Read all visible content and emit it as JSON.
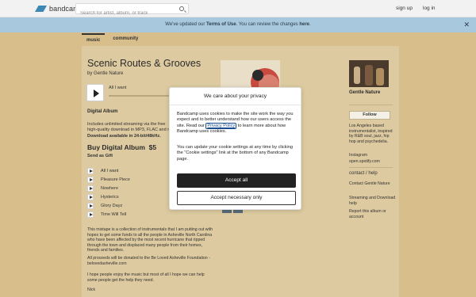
{
  "header": {
    "logo_text": "bandcamp",
    "search_placeholder": "Search for artist, album, or track",
    "signup": "sign up",
    "login": "log in"
  },
  "notice": {
    "prefix": "We've updated our ",
    "terms": "Terms of Use",
    "middle": ". You can review the changes ",
    "here": "here",
    "suffix": ".",
    "close": "✕"
  },
  "tabs": [
    {
      "label": "music",
      "active": true
    },
    {
      "label": "community",
      "active": false
    }
  ],
  "album": {
    "title": "Scenic Routes & Grooves",
    "by_prefix": "by ",
    "artist": "Gentle Nature",
    "now_playing": "All I want",
    "digital_album_heading": "Digital Album",
    "includes_1": "Includes unlimited streaming via the free",
    "includes_2": "high-quality download in MP3, FLAC and m",
    "download_note": "Download available in 24-bit/48kHz.",
    "buy_label": "Buy Digital Album",
    "price": "$5",
    "send_gift": "Send as Gift"
  },
  "tracks": [
    "All I want",
    "Pleasure Piece",
    "Nowhere",
    "Hysterics",
    "Glory Dayz",
    "Time Will Tell"
  ],
  "about": {
    "p1": "This mixtape is a collection of instrumentals that I am putting out with hopes to get some funds to all the people in Asheville North Carolina who have been affected by the most recent hurricane that ripped through the town and displaced many people from their homes, friends and families.",
    "p2": "All proceeds will be donated to the Be Loved Asheville Foundation - belovedasheville.com",
    "p3": "I hope people enjoy the music but most of all I hope we can help some people get the help they need.",
    "p4": "Nick"
  },
  "sidebar": {
    "band_name": "Gentle Nature",
    "follow": "Follow",
    "bio": "Los Angeles based instrumentalist, inspired by R&B soul, jazz, hip hop and psychedelia.",
    "link1": "Instagram",
    "link2": "open.spotify.com",
    "contact_heading": "contact / help",
    "contact_link": "Contact Gentle Nature",
    "streaming_link": "Streaming and Download help",
    "report_link": "Report this album or account"
  },
  "cookie_modal": {
    "title": "We care about your privacy",
    "p1_before": "Bandcamp uses cookies to make the site work the way you expect and to better understand how our users access the site. Read our ",
    "policy": "Privacy Policy",
    "p1_after": " to learn more about how Bandcamp uses cookies.",
    "p2": "You can update your cookie settings at any time by clicking the \"Cookie settings\" link at the bottom of any Bandcamp page.",
    "accept_all": "Accept all",
    "accept_necessary": "Accept necessary only"
  },
  "colors": {
    "page_bg": "#d7be8b",
    "banner": "#a8c8dd",
    "accent_link": "#1a4d8f"
  }
}
